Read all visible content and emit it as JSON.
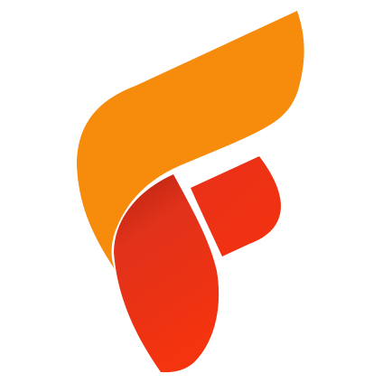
{
  "logo": {
    "name": "F",
    "colors": {
      "orange": "#F68B0C",
      "red": "#F4330F",
      "dark_red": "#B52312",
      "background": "#FFFFFF"
    }
  }
}
